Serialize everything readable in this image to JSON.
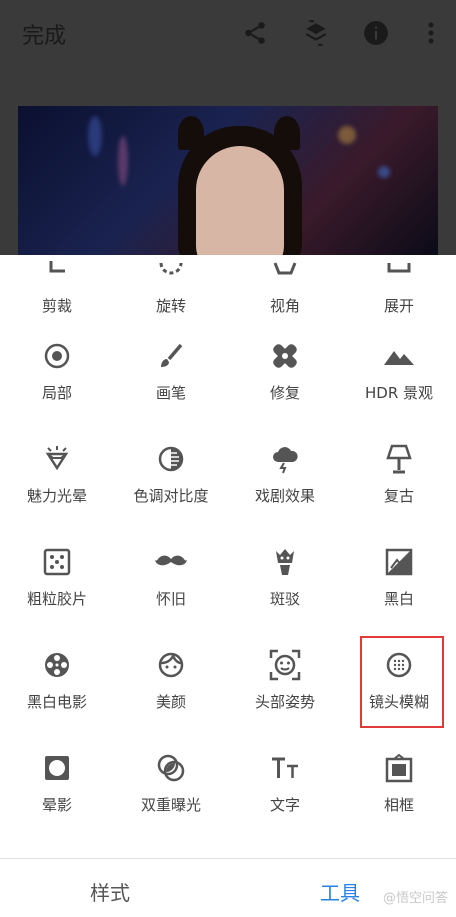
{
  "header": {
    "done_label": "完成",
    "icons": [
      "share-icon",
      "layers-icon",
      "info-icon",
      "more-icon"
    ]
  },
  "tools": [
    {
      "label": "剪裁",
      "icon": "crop-icon"
    },
    {
      "label": "旋转",
      "icon": "rotate-icon"
    },
    {
      "label": "视角",
      "icon": "perspective-icon"
    },
    {
      "label": "展开",
      "icon": "expand-icon"
    },
    {
      "label": "局部",
      "icon": "selective-icon"
    },
    {
      "label": "画笔",
      "icon": "brush-icon"
    },
    {
      "label": "修复",
      "icon": "healing-icon"
    },
    {
      "label": "HDR 景观",
      "icon": "hdr-mountain-icon"
    },
    {
      "label": "魅力光晕",
      "icon": "glamour-glow-icon"
    },
    {
      "label": "色调对比度",
      "icon": "tonal-contrast-icon"
    },
    {
      "label": "戏剧效果",
      "icon": "drama-cloud-icon"
    },
    {
      "label": "复古",
      "icon": "vintage-lamp-icon"
    },
    {
      "label": "粗粒胶片",
      "icon": "grainy-film-icon"
    },
    {
      "label": "怀旧",
      "icon": "mustache-icon"
    },
    {
      "label": "斑驳",
      "icon": "grunge-icon"
    },
    {
      "label": "黑白",
      "icon": "black-white-icon"
    },
    {
      "label": "黑白电影",
      "icon": "film-reel-icon"
    },
    {
      "label": "美颜",
      "icon": "face-icon"
    },
    {
      "label": "头部姿势",
      "icon": "head-pose-icon"
    },
    {
      "label": "镜头模糊",
      "icon": "lens-blur-icon"
    },
    {
      "label": "晕影",
      "icon": "vignette-icon"
    },
    {
      "label": "双重曝光",
      "icon": "double-exposure-icon"
    },
    {
      "label": "文字",
      "icon": "text-icon"
    },
    {
      "label": "相框",
      "icon": "frame-icon"
    }
  ],
  "bottom_tabs": {
    "styles": "样式",
    "tools": "工具"
  },
  "watermark": "@悟空问答",
  "colors": {
    "accent": "#2a82e4",
    "highlight": "#e23a3a",
    "icon": "#555555"
  }
}
